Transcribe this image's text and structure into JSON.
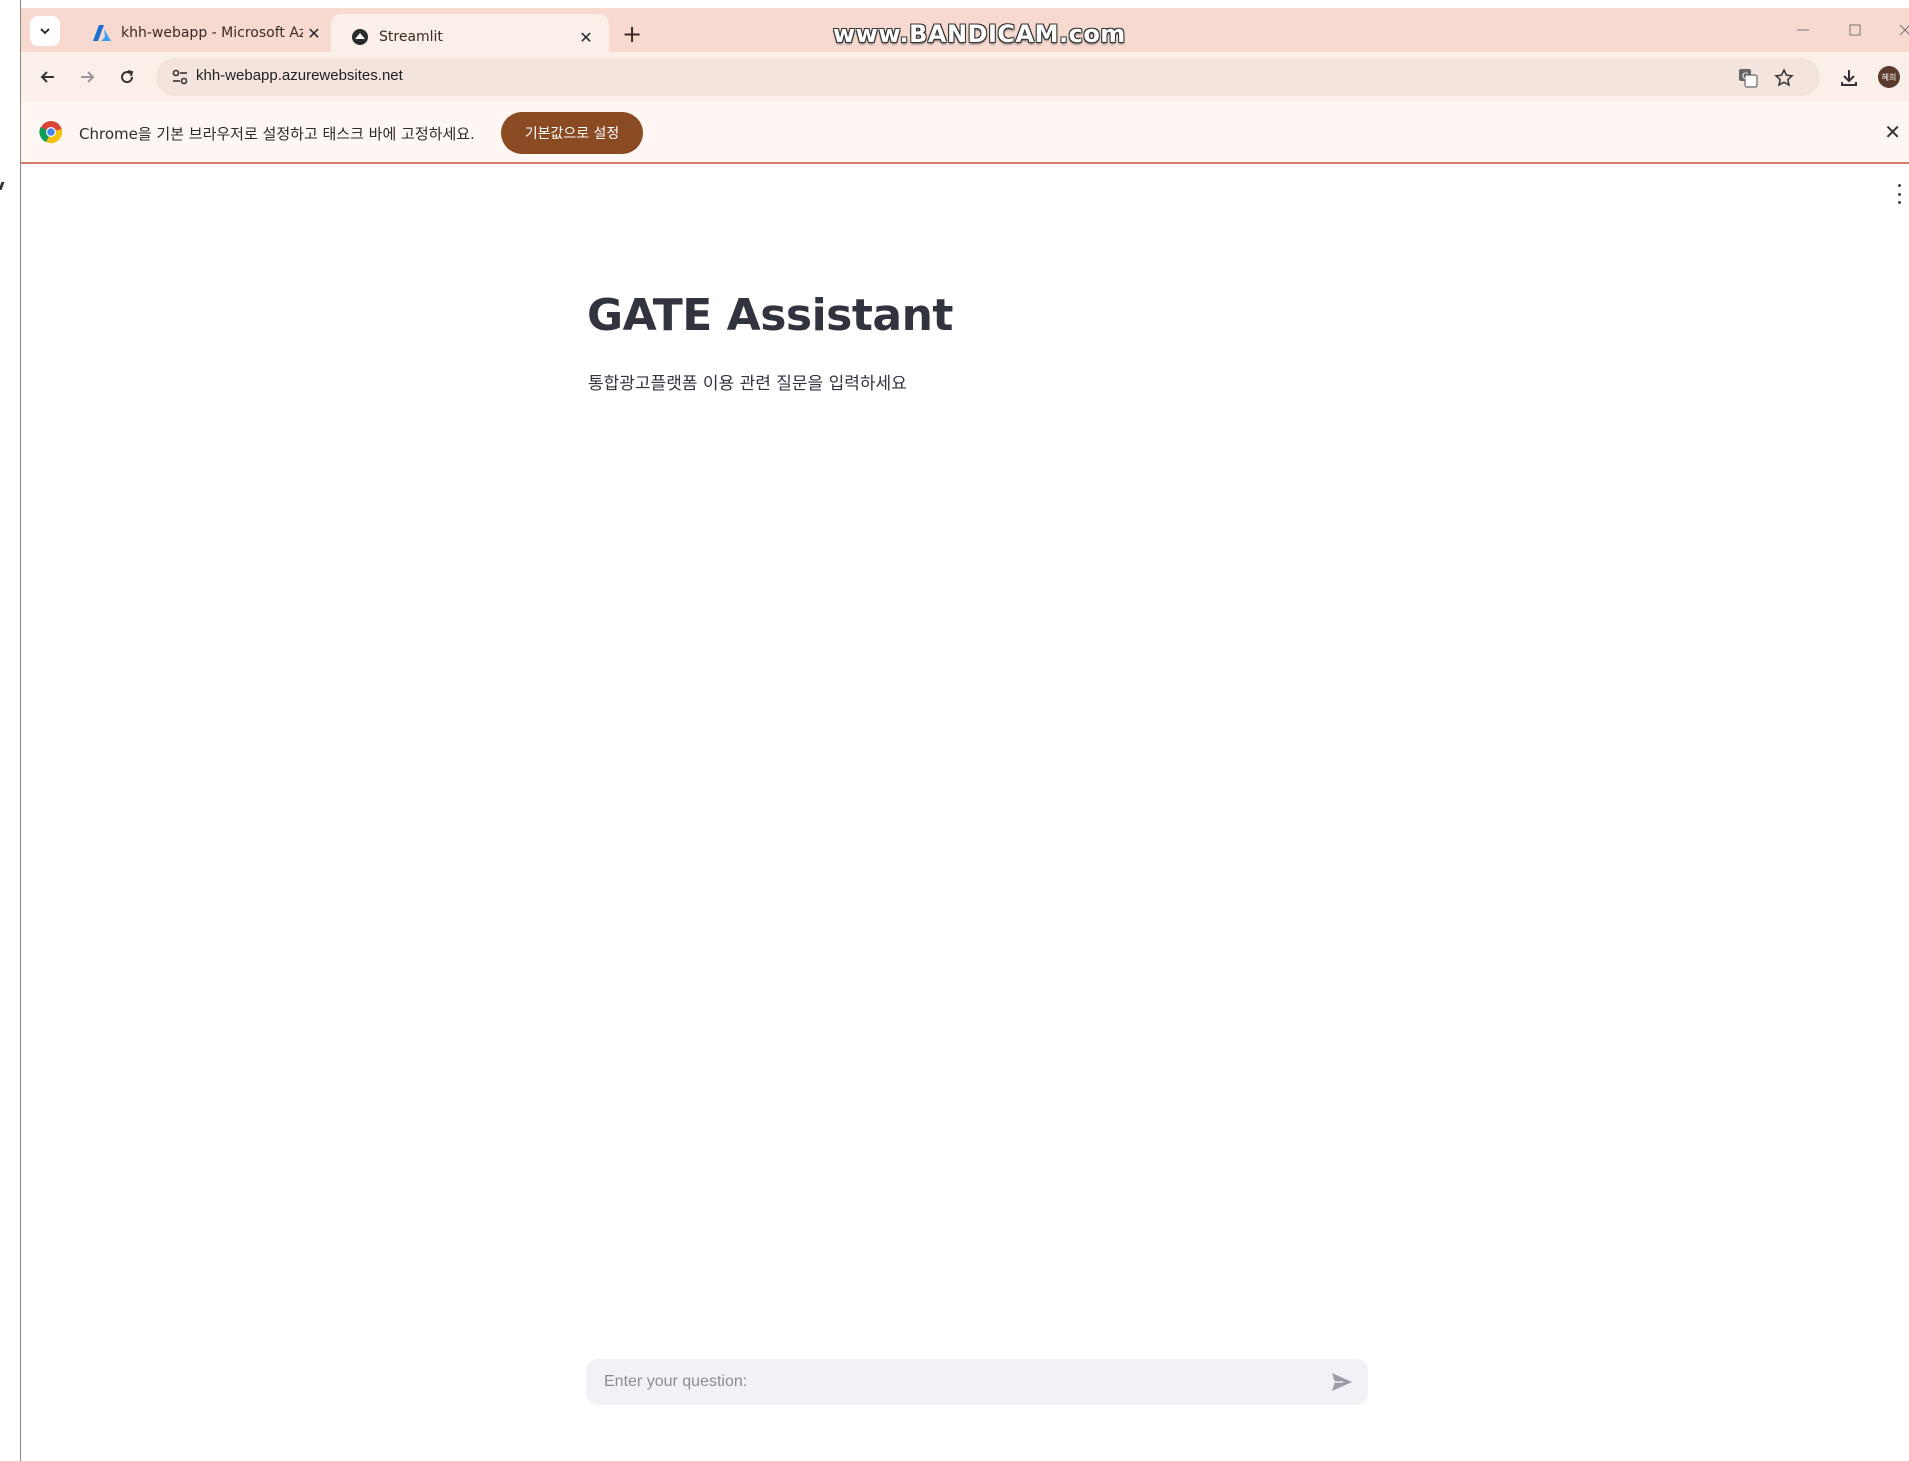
{
  "browser": {
    "tabs": [
      {
        "title": "khh-webapp - Microsoft Azure",
        "icon": "azure-icon",
        "active": false
      },
      {
        "title": "Streamlit",
        "icon": "streamlit-icon",
        "active": true
      }
    ],
    "new_tab_label": "+",
    "watermark": "www.BANDICAM.com",
    "url": "khh-webapp.azurewebsites.net",
    "infobar": {
      "message": "Chrome을 기본 브라우저로 설정하고 태스크 바에 고정하세요.",
      "button_label": "기본값으로 설정"
    },
    "avatar_label": "혜희",
    "colors": {
      "tabstrip": "#f7d9cf",
      "toolbar": "#fbefe9",
      "infobar_button": "#8a4a22"
    }
  },
  "app": {
    "title": "GATE Assistant",
    "subtitle": "통합광고플랫폼 이용 관련 질문을 입력하세요",
    "chat_input": {
      "placeholder": "Enter your question:",
      "value": ""
    },
    "colors": {
      "text": "#31333f",
      "input_bg": "#f0f2f6"
    }
  }
}
